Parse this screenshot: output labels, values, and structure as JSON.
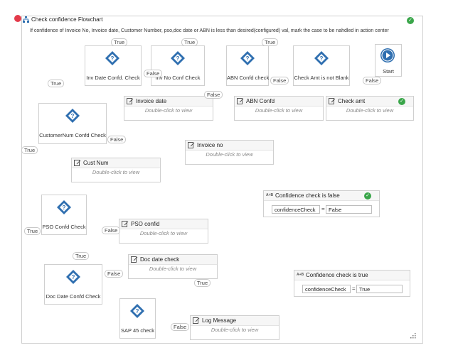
{
  "window": {
    "title": "Check confidence Flowchart",
    "description": "If confidence of Invoice No, Invoice date, Customer Number, pso,doc date or ABN is less than desired(configured) val, mark the case to be nahdled in action center",
    "status": "valid"
  },
  "colors": {
    "diamond": "#2f6fb0",
    "check": "#3aa64a",
    "start": "#2f6fb0",
    "line": "#9a9a9a"
  },
  "start": {
    "label": "Start",
    "icon": "play-icon"
  },
  "decisions": {
    "inv_date": "Inv Date Confd. Check",
    "inv_no": "Inv No Conf Check",
    "abn": "ABN Confd check",
    "check_amt": "Check Amt is not Blank",
    "customer_num": "CustomerNum Confd Check",
    "pso": "PSO Confd Check",
    "doc_date": "Doc Date Confd Check",
    "sap45": "SAP 45 check"
  },
  "activities": {
    "invoice_date": {
      "title": "Invoice date",
      "hint": "Double-click to view"
    },
    "abn_confd": {
      "title": "ABN Confd",
      "hint": "Double-click to view"
    },
    "check_amt": {
      "title": "Check amt",
      "hint": "Double-click to view"
    },
    "invoice_no": {
      "title": "Invoice no",
      "hint": "Double-click to view"
    },
    "cust_num": {
      "title": "Cust Num",
      "hint": "Double-click to view"
    },
    "pso_confid": {
      "title": "PSO confid",
      "hint": "Double-click to view"
    },
    "doc_date_check": {
      "title": "Doc date check",
      "hint": "Double-click to view"
    },
    "log_message": {
      "title": "Log Message",
      "hint": "Double-click to view"
    }
  },
  "assigns": {
    "false_assign": {
      "title": "Confidence check is false",
      "variable": "confidenceCheck",
      "value": "False",
      "icon_text": "A+B"
    },
    "true_assign": {
      "title": "Confidence check is true",
      "variable": "confidenceCheck",
      "value": "True",
      "icon_text": "A+B"
    }
  },
  "labels": {
    "true": "True",
    "false": "False",
    "equals": "="
  }
}
